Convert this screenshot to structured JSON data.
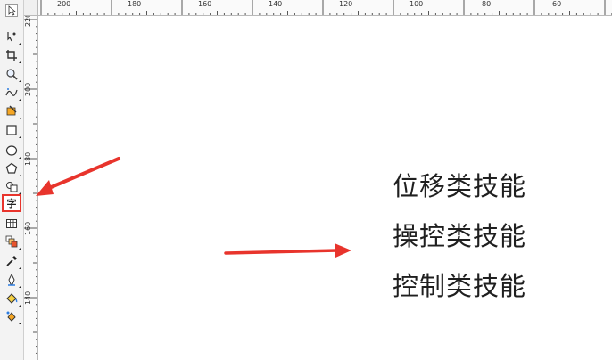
{
  "toolbox": {
    "tools": [
      {
        "id": "pick",
        "icon": "pointer-arrow-icon",
        "label": ""
      },
      {
        "id": "shape",
        "icon": "shape-edit-icon",
        "label": ""
      },
      {
        "id": "crop",
        "icon": "crop-icon",
        "label": ""
      },
      {
        "id": "zoom",
        "icon": "zoom-icon",
        "label": ""
      },
      {
        "id": "freehand",
        "icon": "freehand-icon",
        "label": ""
      },
      {
        "id": "smart-fill",
        "icon": "smart-fill-icon",
        "label": ""
      },
      {
        "id": "rectangle",
        "icon": "rectangle-icon",
        "label": ""
      },
      {
        "id": "ellipse",
        "icon": "ellipse-icon",
        "label": ""
      },
      {
        "id": "polygon",
        "icon": "polygon-icon",
        "label": ""
      },
      {
        "id": "basic-shapes",
        "icon": "basic-shapes-icon",
        "label": ""
      },
      {
        "id": "text",
        "icon": "text-tool-icon",
        "label": "字",
        "active": true
      },
      {
        "id": "table",
        "icon": "table-icon",
        "label": ""
      },
      {
        "id": "blend",
        "icon": "blend-icon",
        "label": ""
      },
      {
        "id": "eyedropper",
        "icon": "eyedropper-icon",
        "label": ""
      },
      {
        "id": "outline",
        "icon": "outline-pen-icon",
        "label": ""
      },
      {
        "id": "fill",
        "icon": "fill-bucket-icon",
        "label": ""
      },
      {
        "id": "interactive-fill",
        "icon": "interactive-fill-icon",
        "label": ""
      }
    ]
  },
  "ruler_top": {
    "labels": [
      "200",
      "180",
      "160",
      "140",
      "120",
      "100",
      "80",
      "60"
    ]
  },
  "ruler_left": {
    "labels": [
      "220",
      "200",
      "180",
      "160",
      "140"
    ]
  },
  "canvas": {
    "skills": [
      "位移类技能",
      "操控类技能",
      "控制类技能"
    ]
  },
  "colors": {
    "accent_red": "#e8342c"
  }
}
